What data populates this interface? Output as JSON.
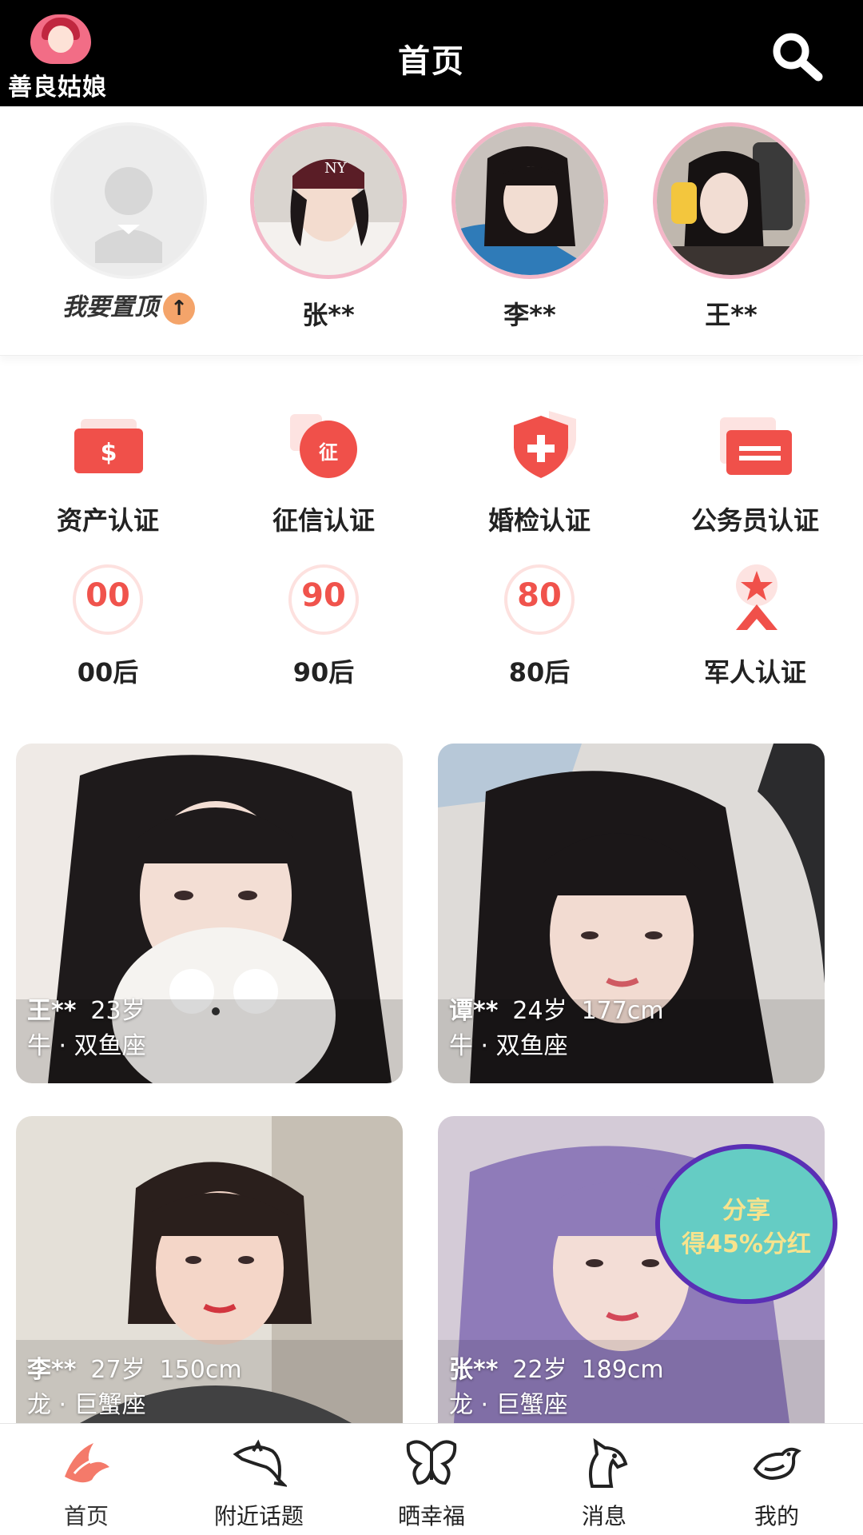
{
  "app": {
    "name": "善良姑娘",
    "title": "首页"
  },
  "stories": {
    "pin_label": "我要置顶",
    "pin_arrow": "↑",
    "items": [
      {
        "name": "张**"
      },
      {
        "name": "李**"
      },
      {
        "name": "王**"
      }
    ]
  },
  "certifications": [
    {
      "label": "资产认证",
      "icon": "money-badge-icon"
    },
    {
      "label": "征信认证",
      "icon": "credit-icon",
      "glyph": "征"
    },
    {
      "label": "婚检认证",
      "icon": "medical-shield-icon"
    },
    {
      "label": "公务员认证",
      "icon": "briefcase-icon"
    }
  ],
  "age_filters": [
    {
      "number": "00",
      "label": "00后"
    },
    {
      "number": "90",
      "label": "90后"
    },
    {
      "number": "80",
      "label": "80后"
    },
    {
      "label": "军人认证",
      "icon": "military-star-icon"
    }
  ],
  "profiles": [
    {
      "name": "王**",
      "age": "23岁",
      "height": "",
      "extra": "牛 · 双鱼座"
    },
    {
      "name": "谭**",
      "age": "24岁",
      "height": "177cm",
      "extra": "牛 · 双鱼座"
    },
    {
      "name": "李**",
      "age": "27岁",
      "height": "150cm",
      "extra": "龙 · 巨蟹座"
    },
    {
      "name": "张**",
      "age": "22岁",
      "height": "189cm",
      "extra": "龙 · 巨蟹座"
    }
  ],
  "share_badge": {
    "line1": "分享",
    "line2": "得45%分红"
  },
  "bottom_nav": [
    {
      "label": "首页",
      "icon": "phoenix-icon",
      "active": true
    },
    {
      "label": "附近话题",
      "icon": "dolphin-icon",
      "active": false
    },
    {
      "label": "晒幸福",
      "icon": "butterfly-icon",
      "active": false
    },
    {
      "label": "消息",
      "icon": "horse-icon",
      "active": false
    },
    {
      "label": "我的",
      "icon": "bird-icon",
      "active": false
    }
  ],
  "colors": {
    "header_bg": "#000000",
    "accent_red": "#f0534c",
    "story_ring": "#f4b7c8",
    "share_bg": "#65ccc4",
    "share_border": "#5a2fb5",
    "share_text": "#f7e38d"
  }
}
